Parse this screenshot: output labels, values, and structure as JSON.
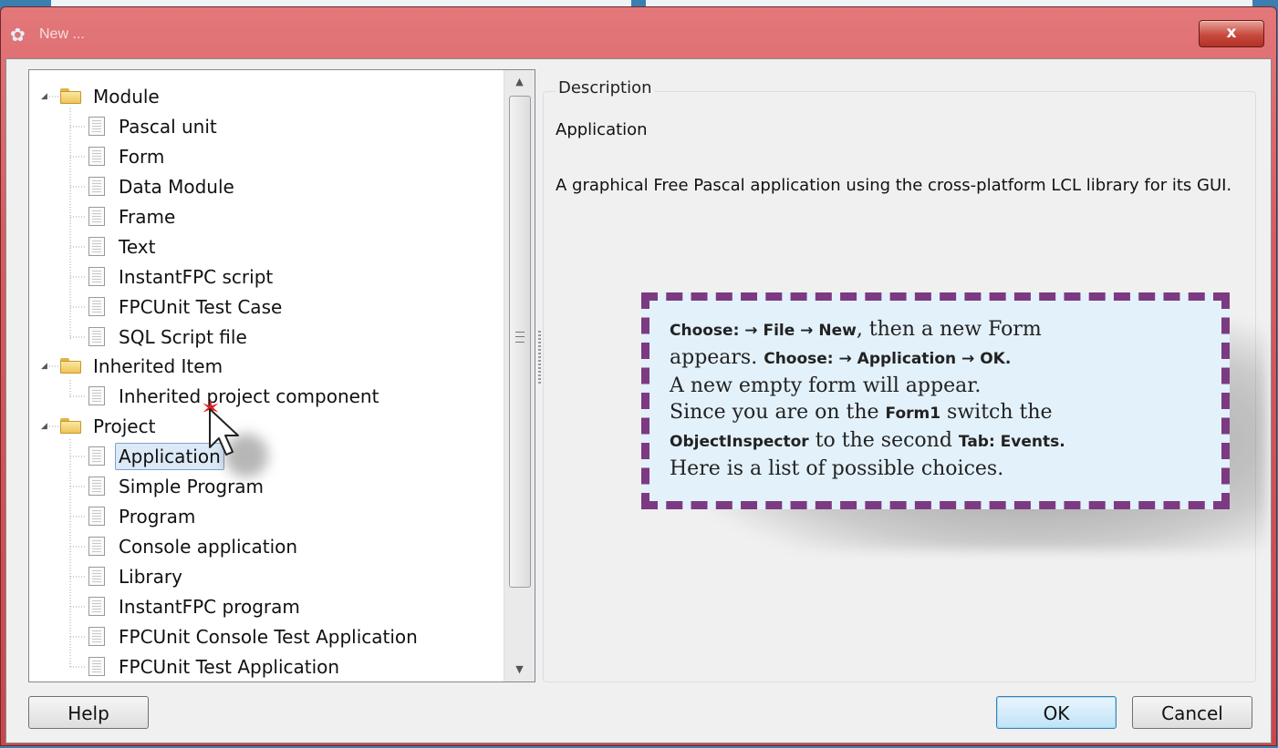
{
  "window": {
    "title": "New ...",
    "close_label": "x"
  },
  "tree": {
    "groups": [
      {
        "label": "Module",
        "items": [
          "Pascal unit",
          "Form",
          "Data Module",
          "Frame",
          "Text",
          "InstantFPC script",
          "FPCUnit Test Case",
          "SQL Script file"
        ]
      },
      {
        "label": "Inherited Item",
        "items": [
          "Inherited project component"
        ]
      },
      {
        "label": "Project",
        "items": [
          "Application",
          "Simple Program",
          "Program",
          "Console application",
          "Library",
          "InstantFPC program",
          "FPCUnit Console Test Application",
          "FPCUnit Test Application"
        ]
      }
    ],
    "selected": "Application"
  },
  "description": {
    "legend": "Description",
    "title": "Application",
    "body": "A graphical Free Pascal application using the cross-platform LCL library for its GUI."
  },
  "buttons": {
    "help": "Help",
    "ok": "OK",
    "cancel": "Cancel"
  },
  "callout": {
    "line1_bold": "Choose: → File →  New",
    "line1_rest": ", then a new Form",
    "line2_start": "appears. ",
    "line2_bold": "Choose: → Application → OK.",
    "line3": "A new empty form will appear.",
    "line4_start": "Since you are on the ",
    "line4_bold": "Form1",
    "line4_rest": " switch the",
    "line5_bold1": "ObjectInspector",
    "line5_mid": " to the second ",
    "line5_bold2": "Tab: Events.",
    "line6": "Here is a list of possible choices."
  },
  "colors": {
    "titlebar": "#d85d5f",
    "callout_border": "#7c3a82",
    "callout_bg": "#e3f1fb",
    "selection": "#dce9f7"
  }
}
